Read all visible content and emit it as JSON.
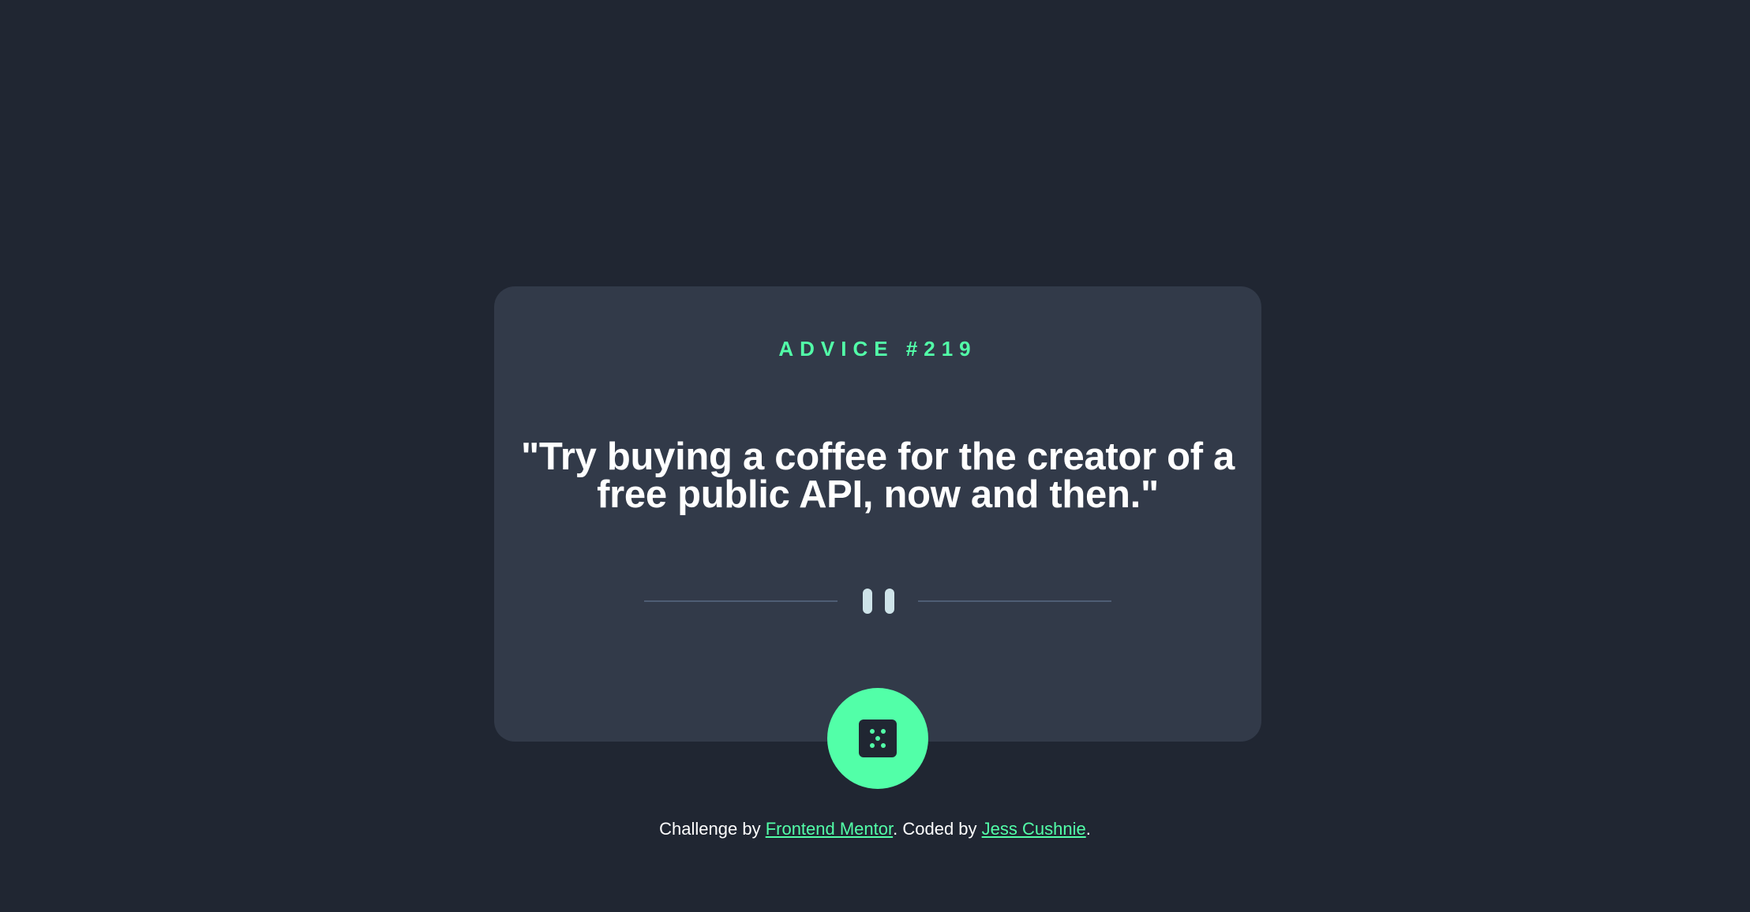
{
  "card": {
    "advice_label": "ADVICE #219",
    "quote": "\"Try buying a coffee for the creator of a free public API, now and then.\""
  },
  "button": {
    "icon": "dice-icon"
  },
  "footer": {
    "prefix": "Challenge by ",
    "link1": "Frontend Mentor",
    "middle": ". Coded by ",
    "link2": "Jess Cushnie",
    "suffix": "."
  },
  "colors": {
    "background": "#202632",
    "card": "#323a49",
    "accent": "#52ffa8",
    "text": "#ffffff",
    "divider": "#4f5d74",
    "pause": "#cee3e9"
  }
}
